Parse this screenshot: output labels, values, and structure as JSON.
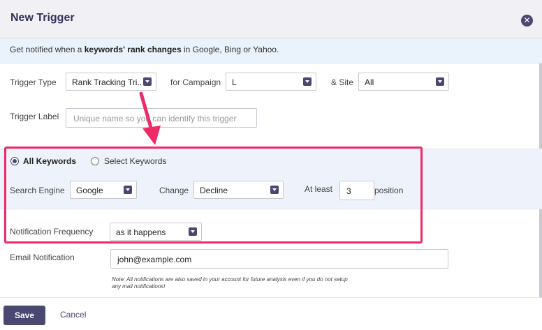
{
  "dialog": {
    "title": "New Trigger",
    "close_icon": "close-icon",
    "info_prefix": "Get notified when a ",
    "info_bold": "keywords' rank changes",
    "info_suffix": " in Google, Bing or Yahoo."
  },
  "form": {
    "trigger_type_label": "Trigger Type",
    "trigger_type_value": "Rank Tracking Tri...",
    "campaign_label": "for Campaign",
    "campaign_value": "L",
    "site_label": "& Site",
    "site_value": "All",
    "trigger_label_label": "Trigger Label",
    "trigger_label_placeholder": "Unique name so you can identify this trigger",
    "all_keywords_label": "All Keywords",
    "select_keywords_label": "Select Keywords",
    "keywords_selected": "All Keywords",
    "search_engine_label": "Search Engine",
    "search_engine_value": "Google",
    "change_label": "Change",
    "change_value": "Decline",
    "at_least_label": "At least",
    "at_least_value": "3",
    "position_label": "position",
    "frequency_label": "Notification Frequency",
    "frequency_value": "as it happens",
    "email_label": "Email Notification",
    "email_value": "john@example.com",
    "note_line1": "Note: All notifications are also saved in your account for future analysis even if you do not setup",
    "note_line2": "any mail notifications!"
  },
  "footer": {
    "save_label": "Save",
    "cancel_label": "Cancel"
  },
  "colors": {
    "accent": "#4a4870",
    "highlight": "#ef2b67",
    "band": "#eef3fb"
  }
}
